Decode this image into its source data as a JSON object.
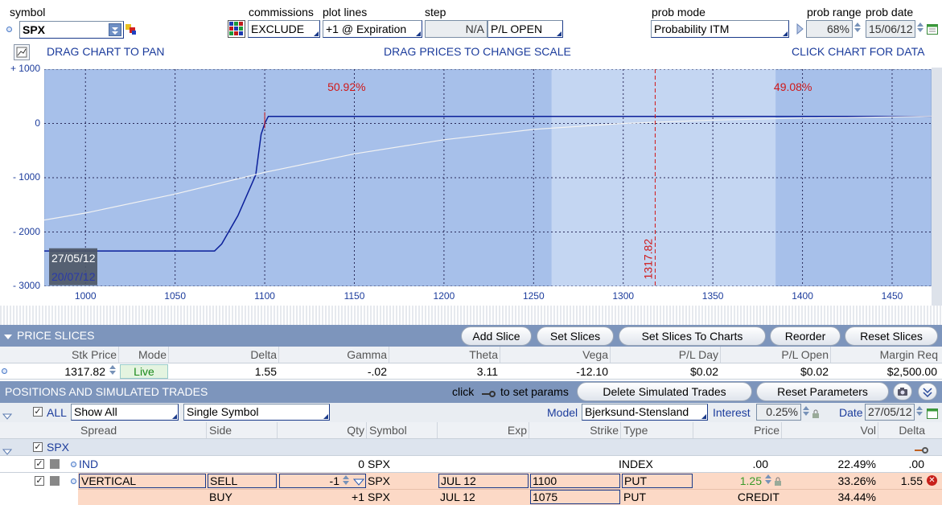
{
  "header": {
    "symbol_label": "symbol",
    "symbol_value": "SPX",
    "commissions_label": "commissions",
    "commissions_value": "EXCLUDE",
    "plot_lines_label": "plot lines",
    "plot_lines_value": "+1 @ Expiration",
    "step_label": "step",
    "step_value": "N/A",
    "pl_mode_value": "P/L OPEN",
    "prob_mode_label": "prob mode",
    "prob_mode_value": "Probability ITM",
    "prob_range_label": "prob range",
    "prob_range_value": "68%",
    "prob_date_label": "prob date",
    "prob_date_value": "15/06/12"
  },
  "chart_hints": {
    "pan": "DRAG CHART TO PAN",
    "scale": "DRAG PRICES TO CHANGE SCALE",
    "click": "CLICK CHART FOR DATA"
  },
  "chart_data": {
    "type": "line",
    "y_ticks": [
      "+ 1000",
      "0",
      "- 1000",
      "- 2000",
      "- 3000"
    ],
    "x_ticks": [
      "1000",
      "1050",
      "1100",
      "1150",
      "1200",
      "1250",
      "1300",
      "1350",
      "1400",
      "1450"
    ],
    "xlim": [
      977,
      1472
    ],
    "ylim": [
      -3000,
      1000
    ],
    "prob_left": "50.92%",
    "prob_right": "49.08%",
    "price_marker": "1317.82",
    "price_marker_value": 1317.82,
    "prob_range_x": [
      1260,
      1385
    ],
    "date_label_1": "27/05/12",
    "date_label_2": "20/07/12",
    "series": [
      {
        "color": "#0b1f9a",
        "x": [
          977,
          1072,
          1076,
          1085,
          1095,
          1098,
          1100,
          1102,
          1105,
          1472
        ],
        "values": [
          -2350,
          -2350,
          -2220,
          -1700,
          -950,
          -200,
          0,
          130,
          130,
          130
        ]
      },
      {
        "color": "#f2f2f2",
        "x": [
          977,
          1000,
          1050,
          1100,
          1150,
          1200,
          1250,
          1300,
          1350,
          1400,
          1472
        ],
        "values": [
          -1780,
          -1650,
          -1300,
          -900,
          -560,
          -300,
          -110,
          0,
          60,
          100,
          130
        ]
      }
    ]
  },
  "price_slices": {
    "title": "PRICE SLICES",
    "buttons": [
      "Add Slice",
      "Set Slices",
      "Set Slices To Charts",
      "Reorder",
      "Reset Slices"
    ],
    "columns": [
      "Stk Price",
      "Mode",
      "Delta",
      "Gamma",
      "Theta",
      "Vega",
      "P/L Day",
      "P/L Open",
      "Margin Req"
    ],
    "row": {
      "stk_price": "1317.82",
      "mode": "Live",
      "delta": "1.55",
      "gamma": "-.02",
      "theta": "3.11",
      "vega": "-12.10",
      "pl_day": "$0.02",
      "pl_open": "$0.02",
      "margin_req": "$2,500.00"
    }
  },
  "positions": {
    "title": "POSITIONS AND SIMULATED TRADES",
    "click_text": "click",
    "set_params_text": "to set params",
    "delete_btn": "Delete Simulated Trades",
    "reset_btn": "Reset Parameters",
    "all_label": "ALL",
    "filter_value": "Show All",
    "symbol_mode_value": "Single Symbol",
    "model_label": "Model",
    "model_value": "Bjerksund-Stensland",
    "interest_label": "Interest",
    "interest_value": "0.25%",
    "date_label": "Date",
    "date_value": "27/05/12",
    "columns": [
      "Spread",
      "Side",
      "Qty",
      "Symbol",
      "Exp",
      "Strike",
      "Type",
      "Price",
      "Vol",
      "Delta"
    ],
    "group": "SPX",
    "rows": [
      {
        "spread": "IND",
        "side": "",
        "qty": "0",
        "symbol": "SPX",
        "exp": "",
        "strike": "",
        "type": "INDEX",
        "price": ".00",
        "vol": "22.49%",
        "delta": ".00"
      },
      {
        "spread": "VERTICAL",
        "side": "SELL",
        "qty": "-1",
        "symbol": "SPX",
        "exp": "JUL 12",
        "strike": "1100",
        "type": "PUT",
        "price": "1.25",
        "vol": "33.26%",
        "delta": "1.55"
      },
      {
        "spread": "",
        "side": "BUY",
        "qty": "+1",
        "symbol": "SPX",
        "exp": "JUL 12",
        "strike": "1075",
        "type": "PUT",
        "price": "CREDIT",
        "vol": "34.44%",
        "delta": ""
      }
    ]
  }
}
